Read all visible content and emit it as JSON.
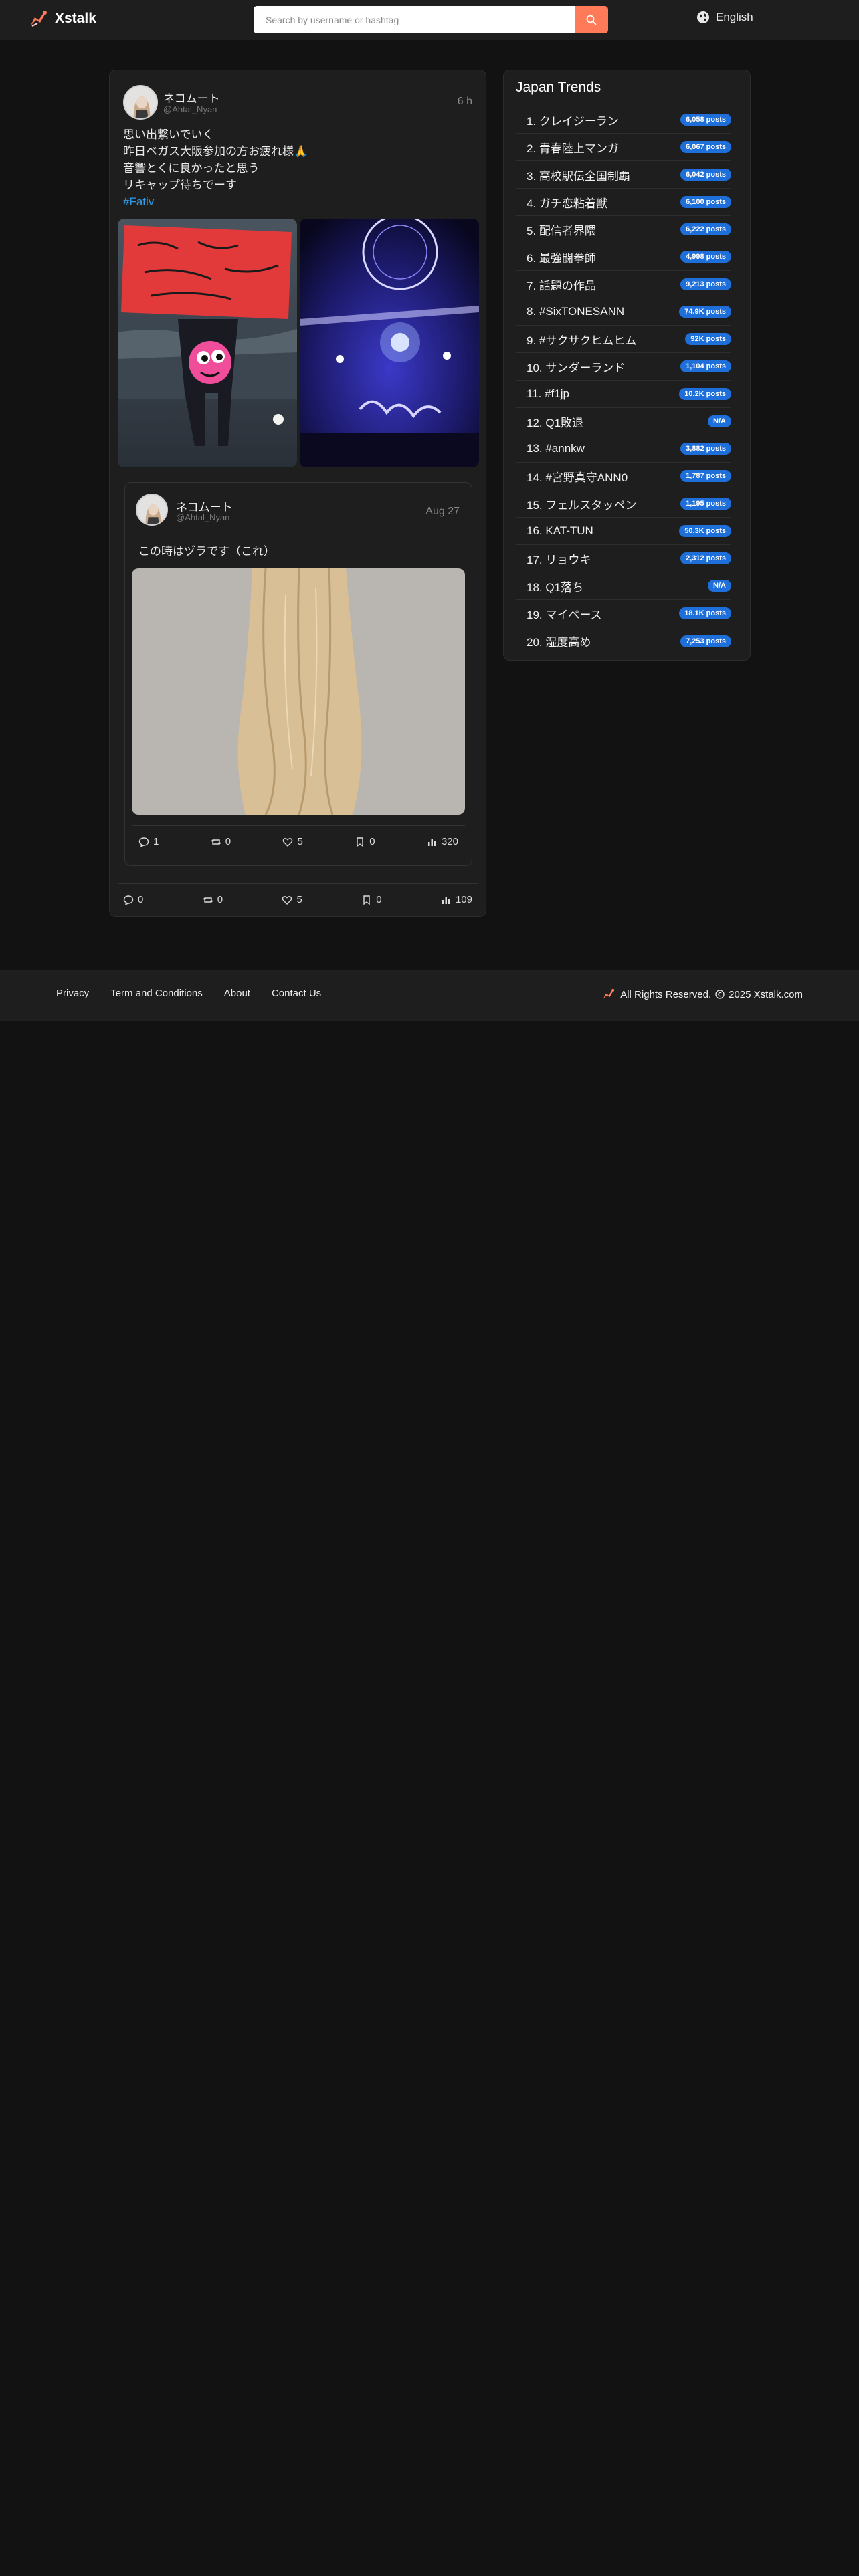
{
  "header": {
    "brand": "Xstalk",
    "search_placeholder": "Search by username or hashtag",
    "language": "English"
  },
  "colors": {
    "accent": "#ff7a59",
    "badge": "#1e6fd9",
    "hashtag": "#2f9be8",
    "background": "#121212",
    "card": "#1e1e1e"
  },
  "post": {
    "display_name": "ネコムート",
    "handle": "@Ahtal_Nyan",
    "time": "6 h",
    "lines": [
      "思い出繋いでいく",
      "昨日ベガス大阪参加の方お疲れ様🙏",
      "音響とくに良かったと思う",
      "リキャップ待ちでーす"
    ],
    "hashtag": "#Fativ",
    "stats": {
      "replies": "0",
      "reposts": "0",
      "likes": "5",
      "bookmarks": "0",
      "views": "109"
    },
    "quoted": {
      "display_name": "ネコムート",
      "handle": "@Ahtal_Nyan",
      "time": "Aug 27",
      "text": "この時はヅラです（これ）",
      "stats": {
        "replies": "1",
        "reposts": "0",
        "likes": "5",
        "bookmarks": "0",
        "views": "320"
      }
    }
  },
  "trends": {
    "title": "Japan Trends",
    "items": [
      {
        "name": "1. クレイジーラン",
        "count": "6,058 posts"
      },
      {
        "name": "2. 青春陸上マンガ",
        "count": "6,067 posts"
      },
      {
        "name": "3. 高校駅伝全国制覇",
        "count": "6,042 posts"
      },
      {
        "name": "4. ガチ恋粘着獣",
        "count": "6,100 posts"
      },
      {
        "name": "5. 配信者界隈",
        "count": "6,222 posts"
      },
      {
        "name": "6. 最強闘拳師",
        "count": "4,998 posts"
      },
      {
        "name": "7. 話題の作品",
        "count": "9,213 posts"
      },
      {
        "name": "8. #SixTONESANN",
        "count": "74.9K posts"
      },
      {
        "name": "9. #サクサクヒムヒム",
        "count": "92K posts"
      },
      {
        "name": "10. サンダーランド",
        "count": "1,104 posts"
      },
      {
        "name": "11. #f1jp",
        "count": "10.2K posts"
      },
      {
        "name": "12. Q1敗退",
        "count": "N/A"
      },
      {
        "name": "13. #annkw",
        "count": "3,882 posts"
      },
      {
        "name": "14. #宮野真守ANN0",
        "count": "1,787 posts"
      },
      {
        "name": "15. フェルスタッペン",
        "count": "1,195 posts"
      },
      {
        "name": "16. KAT-TUN",
        "count": "50.3K posts"
      },
      {
        "name": "17. リョウキ",
        "count": "2,312 posts"
      },
      {
        "name": "18. Q1落ち",
        "count": "N/A"
      },
      {
        "name": "19. マイペース",
        "count": "18.1K posts"
      },
      {
        "name": "20. 湿度高め",
        "count": "7,253 posts"
      }
    ]
  },
  "footer": {
    "links": [
      "Privacy",
      "Term and Conditions",
      "About",
      "Contact Us"
    ],
    "rights": "All Rights Reserved.",
    "copyright": "2025 Xstalk.com"
  }
}
